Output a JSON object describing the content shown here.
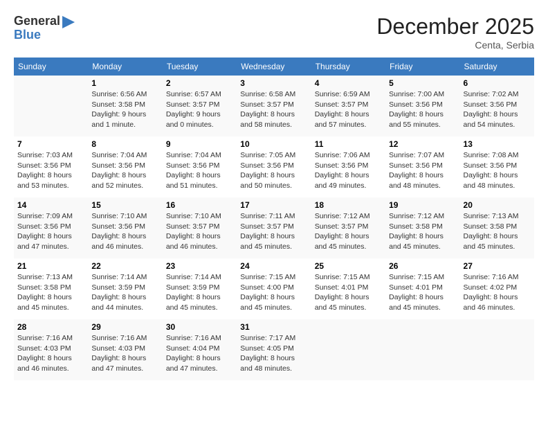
{
  "logo": {
    "general": "General",
    "blue": "Blue"
  },
  "title": "December 2025",
  "location": "Centa, Serbia",
  "days_of_week": [
    "Sunday",
    "Monday",
    "Tuesday",
    "Wednesday",
    "Thursday",
    "Friday",
    "Saturday"
  ],
  "weeks": [
    [
      {
        "day": "",
        "info": ""
      },
      {
        "day": "1",
        "info": "Sunrise: 6:56 AM\nSunset: 3:58 PM\nDaylight: 9 hours\nand 1 minute."
      },
      {
        "day": "2",
        "info": "Sunrise: 6:57 AM\nSunset: 3:57 PM\nDaylight: 9 hours\nand 0 minutes."
      },
      {
        "day": "3",
        "info": "Sunrise: 6:58 AM\nSunset: 3:57 PM\nDaylight: 8 hours\nand 58 minutes."
      },
      {
        "day": "4",
        "info": "Sunrise: 6:59 AM\nSunset: 3:57 PM\nDaylight: 8 hours\nand 57 minutes."
      },
      {
        "day": "5",
        "info": "Sunrise: 7:00 AM\nSunset: 3:56 PM\nDaylight: 8 hours\nand 55 minutes."
      },
      {
        "day": "6",
        "info": "Sunrise: 7:02 AM\nSunset: 3:56 PM\nDaylight: 8 hours\nand 54 minutes."
      }
    ],
    [
      {
        "day": "7",
        "info": "Sunrise: 7:03 AM\nSunset: 3:56 PM\nDaylight: 8 hours\nand 53 minutes."
      },
      {
        "day": "8",
        "info": "Sunrise: 7:04 AM\nSunset: 3:56 PM\nDaylight: 8 hours\nand 52 minutes."
      },
      {
        "day": "9",
        "info": "Sunrise: 7:04 AM\nSunset: 3:56 PM\nDaylight: 8 hours\nand 51 minutes."
      },
      {
        "day": "10",
        "info": "Sunrise: 7:05 AM\nSunset: 3:56 PM\nDaylight: 8 hours\nand 50 minutes."
      },
      {
        "day": "11",
        "info": "Sunrise: 7:06 AM\nSunset: 3:56 PM\nDaylight: 8 hours\nand 49 minutes."
      },
      {
        "day": "12",
        "info": "Sunrise: 7:07 AM\nSunset: 3:56 PM\nDaylight: 8 hours\nand 48 minutes."
      },
      {
        "day": "13",
        "info": "Sunrise: 7:08 AM\nSunset: 3:56 PM\nDaylight: 8 hours\nand 48 minutes."
      }
    ],
    [
      {
        "day": "14",
        "info": "Sunrise: 7:09 AM\nSunset: 3:56 PM\nDaylight: 8 hours\nand 47 minutes."
      },
      {
        "day": "15",
        "info": "Sunrise: 7:10 AM\nSunset: 3:56 PM\nDaylight: 8 hours\nand 46 minutes."
      },
      {
        "day": "16",
        "info": "Sunrise: 7:10 AM\nSunset: 3:57 PM\nDaylight: 8 hours\nand 46 minutes."
      },
      {
        "day": "17",
        "info": "Sunrise: 7:11 AM\nSunset: 3:57 PM\nDaylight: 8 hours\nand 45 minutes."
      },
      {
        "day": "18",
        "info": "Sunrise: 7:12 AM\nSunset: 3:57 PM\nDaylight: 8 hours\nand 45 minutes."
      },
      {
        "day": "19",
        "info": "Sunrise: 7:12 AM\nSunset: 3:58 PM\nDaylight: 8 hours\nand 45 minutes."
      },
      {
        "day": "20",
        "info": "Sunrise: 7:13 AM\nSunset: 3:58 PM\nDaylight: 8 hours\nand 45 minutes."
      }
    ],
    [
      {
        "day": "21",
        "info": "Sunrise: 7:13 AM\nSunset: 3:58 PM\nDaylight: 8 hours\nand 45 minutes."
      },
      {
        "day": "22",
        "info": "Sunrise: 7:14 AM\nSunset: 3:59 PM\nDaylight: 8 hours\nand 44 minutes."
      },
      {
        "day": "23",
        "info": "Sunrise: 7:14 AM\nSunset: 3:59 PM\nDaylight: 8 hours\nand 45 minutes."
      },
      {
        "day": "24",
        "info": "Sunrise: 7:15 AM\nSunset: 4:00 PM\nDaylight: 8 hours\nand 45 minutes."
      },
      {
        "day": "25",
        "info": "Sunrise: 7:15 AM\nSunset: 4:01 PM\nDaylight: 8 hours\nand 45 minutes."
      },
      {
        "day": "26",
        "info": "Sunrise: 7:15 AM\nSunset: 4:01 PM\nDaylight: 8 hours\nand 45 minutes."
      },
      {
        "day": "27",
        "info": "Sunrise: 7:16 AM\nSunset: 4:02 PM\nDaylight: 8 hours\nand 46 minutes."
      }
    ],
    [
      {
        "day": "28",
        "info": "Sunrise: 7:16 AM\nSunset: 4:03 PM\nDaylight: 8 hours\nand 46 minutes."
      },
      {
        "day": "29",
        "info": "Sunrise: 7:16 AM\nSunset: 4:03 PM\nDaylight: 8 hours\nand 47 minutes."
      },
      {
        "day": "30",
        "info": "Sunrise: 7:16 AM\nSunset: 4:04 PM\nDaylight: 8 hours\nand 47 minutes."
      },
      {
        "day": "31",
        "info": "Sunrise: 7:17 AM\nSunset: 4:05 PM\nDaylight: 8 hours\nand 48 minutes."
      },
      {
        "day": "",
        "info": ""
      },
      {
        "day": "",
        "info": ""
      },
      {
        "day": "",
        "info": ""
      }
    ]
  ]
}
